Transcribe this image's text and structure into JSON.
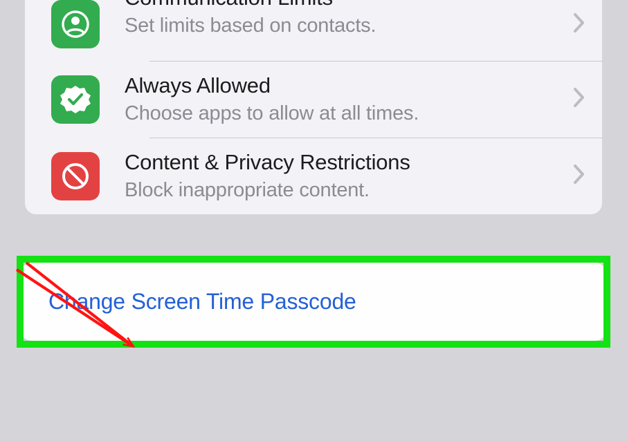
{
  "rows": [
    {
      "title": "Communication Limits",
      "subtitle": "Set limits based on contacts."
    },
    {
      "title": "Always Allowed",
      "subtitle": "Choose apps to allow at all times."
    },
    {
      "title": "Content & Privacy Restrictions",
      "subtitle": "Block inappropriate content."
    }
  ],
  "changePasscode": "Change Screen Time Passcode"
}
